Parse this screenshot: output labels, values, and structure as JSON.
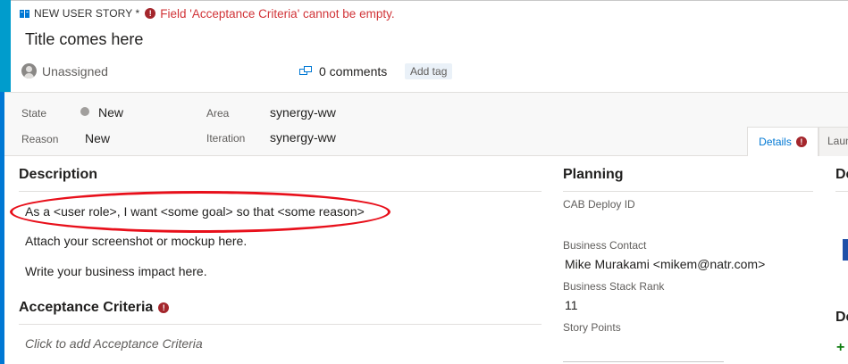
{
  "header": {
    "type_label": "NEW USER STORY *",
    "error_message": "Field 'Acceptance Criteria' cannot be empty.",
    "title": "Title comes here",
    "assigned_to": "Unassigned",
    "comments": "0 comments",
    "add_tag": "Add tag"
  },
  "fields": {
    "state_label": "State",
    "state_value": "New",
    "reason_label": "Reason",
    "reason_value": "New",
    "area_label": "Area",
    "area_value": "synergy-ww",
    "iteration_label": "Iteration",
    "iteration_value": "synergy-ww"
  },
  "tabs": {
    "details": "Details",
    "next": "Laun"
  },
  "description": {
    "heading": "Description",
    "line1": "As a <user role>, I want <some goal> so that <some reason>",
    "line2": "Attach your screenshot or mockup here.",
    "line3": "Write your business impact here."
  },
  "acceptance": {
    "heading": "Acceptance Criteria",
    "placeholder": "Click to add Acceptance Criteria"
  },
  "planning": {
    "heading": "Planning",
    "cab_label": "CAB Deploy ID",
    "contact_label": "Business Contact",
    "contact_value": "Mike Murakami <mikem@natr.com>",
    "rank_label": "Business Stack Rank",
    "rank_value": "11",
    "points_label": "Story Points"
  },
  "right": {
    "heading1": "De",
    "heading2": "De",
    "add": "+"
  },
  "colors": {
    "accent": "#009ccc",
    "error": "#d13438",
    "annotation": "#e8101b",
    "link": "#0078d4"
  }
}
